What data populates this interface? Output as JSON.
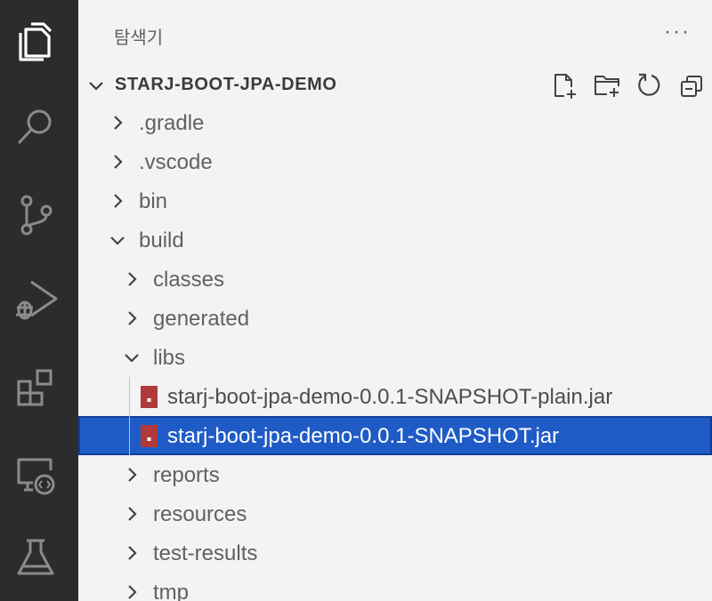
{
  "sidebar": {
    "title": "탐색기",
    "more_actions_glyph": "···"
  },
  "activity_bar": {
    "icons": [
      "files-icon",
      "search-icon",
      "source-control-icon",
      "run-debug-icon",
      "extensions-icon",
      "remote-explorer-icon",
      "testing-icon"
    ]
  },
  "project": {
    "title": "STARJ-BOOT-JPA-DEMO",
    "expanded": true,
    "toolbar": [
      "new-file-icon",
      "new-folder-icon",
      "refresh-icon",
      "collapse-all-icon"
    ]
  },
  "tree": [
    {
      "label": ".gradle",
      "type": "folder",
      "depth": 0,
      "expanded": false
    },
    {
      "label": ".vscode",
      "type": "folder",
      "depth": 0,
      "expanded": false
    },
    {
      "label": "bin",
      "type": "folder",
      "depth": 0,
      "expanded": false
    },
    {
      "label": "build",
      "type": "folder",
      "depth": 0,
      "expanded": true
    },
    {
      "label": "classes",
      "type": "folder",
      "depth": 1,
      "expanded": false
    },
    {
      "label": "generated",
      "type": "folder",
      "depth": 1,
      "expanded": false
    },
    {
      "label": "libs",
      "type": "folder",
      "depth": 1,
      "expanded": true
    },
    {
      "label": "starj-boot-jpa-demo-0.0.1-SNAPSHOT-plain.jar",
      "type": "file",
      "depth": 2,
      "selected": false
    },
    {
      "label": "starj-boot-jpa-demo-0.0.1-SNAPSHOT.jar",
      "type": "file",
      "depth": 2,
      "selected": true
    },
    {
      "label": "reports",
      "type": "folder",
      "depth": 1,
      "expanded": false
    },
    {
      "label": "resources",
      "type": "folder",
      "depth": 1,
      "expanded": false
    },
    {
      "label": "test-results",
      "type": "folder",
      "depth": 1,
      "expanded": false
    },
    {
      "label": "tmp",
      "type": "folder",
      "depth": 1,
      "expanded": false
    }
  ],
  "colors": {
    "activity_bar_bg": "#2c2c2c",
    "sidebar_bg": "#f3f3f3",
    "selection_bg": "#1f5bc6",
    "jar_icon": "#b03a3a"
  }
}
